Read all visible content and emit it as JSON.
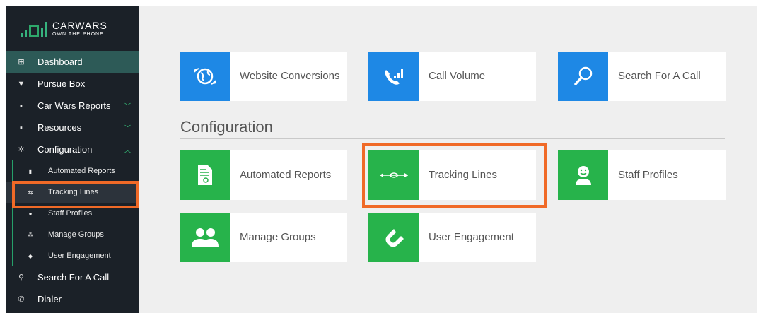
{
  "logo": {
    "title": "CarWars",
    "subtitle": "Own The Phone"
  },
  "sidebar": {
    "items": [
      {
        "label": "Dashboard",
        "icon": "grid-icon"
      },
      {
        "label": "Pursue Box",
        "icon": "box-icon"
      },
      {
        "label": "Car Wars Reports",
        "icon": "chart-icon"
      },
      {
        "label": "Resources",
        "icon": "chart-icon"
      },
      {
        "label": "Configuration",
        "icon": "gear-icon"
      }
    ],
    "subitems": [
      {
        "label": "Automated Reports",
        "icon": "document-icon"
      },
      {
        "label": "Tracking Lines",
        "icon": "tracking-icon"
      },
      {
        "label": "Staff Profiles",
        "icon": "person-icon"
      },
      {
        "label": "Manage Groups",
        "icon": "group-icon"
      },
      {
        "label": "User Engagement",
        "icon": "magnet-icon"
      }
    ],
    "bottom_items": [
      {
        "label": "Search For A Call",
        "icon": "search-icon"
      },
      {
        "label": "Dialer",
        "icon": "phone-icon"
      }
    ]
  },
  "main": {
    "top_tiles": [
      {
        "label": "Website Conversions",
        "icon": "globe-refresh-icon"
      },
      {
        "label": "Call Volume",
        "icon": "phone-volume-icon"
      },
      {
        "label": "Search For A Call",
        "icon": "search-icon"
      }
    ],
    "section_title": "Configuration",
    "config_tiles": [
      {
        "label": "Automated Reports",
        "icon": "document-icon"
      },
      {
        "label": "Tracking Lines",
        "icon": "tracking-icon"
      },
      {
        "label": "Staff Profiles",
        "icon": "smiley-person-icon"
      },
      {
        "label": "Manage Groups",
        "icon": "group-icon"
      },
      {
        "label": "User Engagement",
        "icon": "magnet-icon"
      }
    ]
  },
  "colors": {
    "sidebar_bg": "#1b2128",
    "active_bg": "#2d5a57",
    "accent_green": "#27b34b",
    "accent_blue": "#1e88e5",
    "highlight": "#f06a27"
  }
}
